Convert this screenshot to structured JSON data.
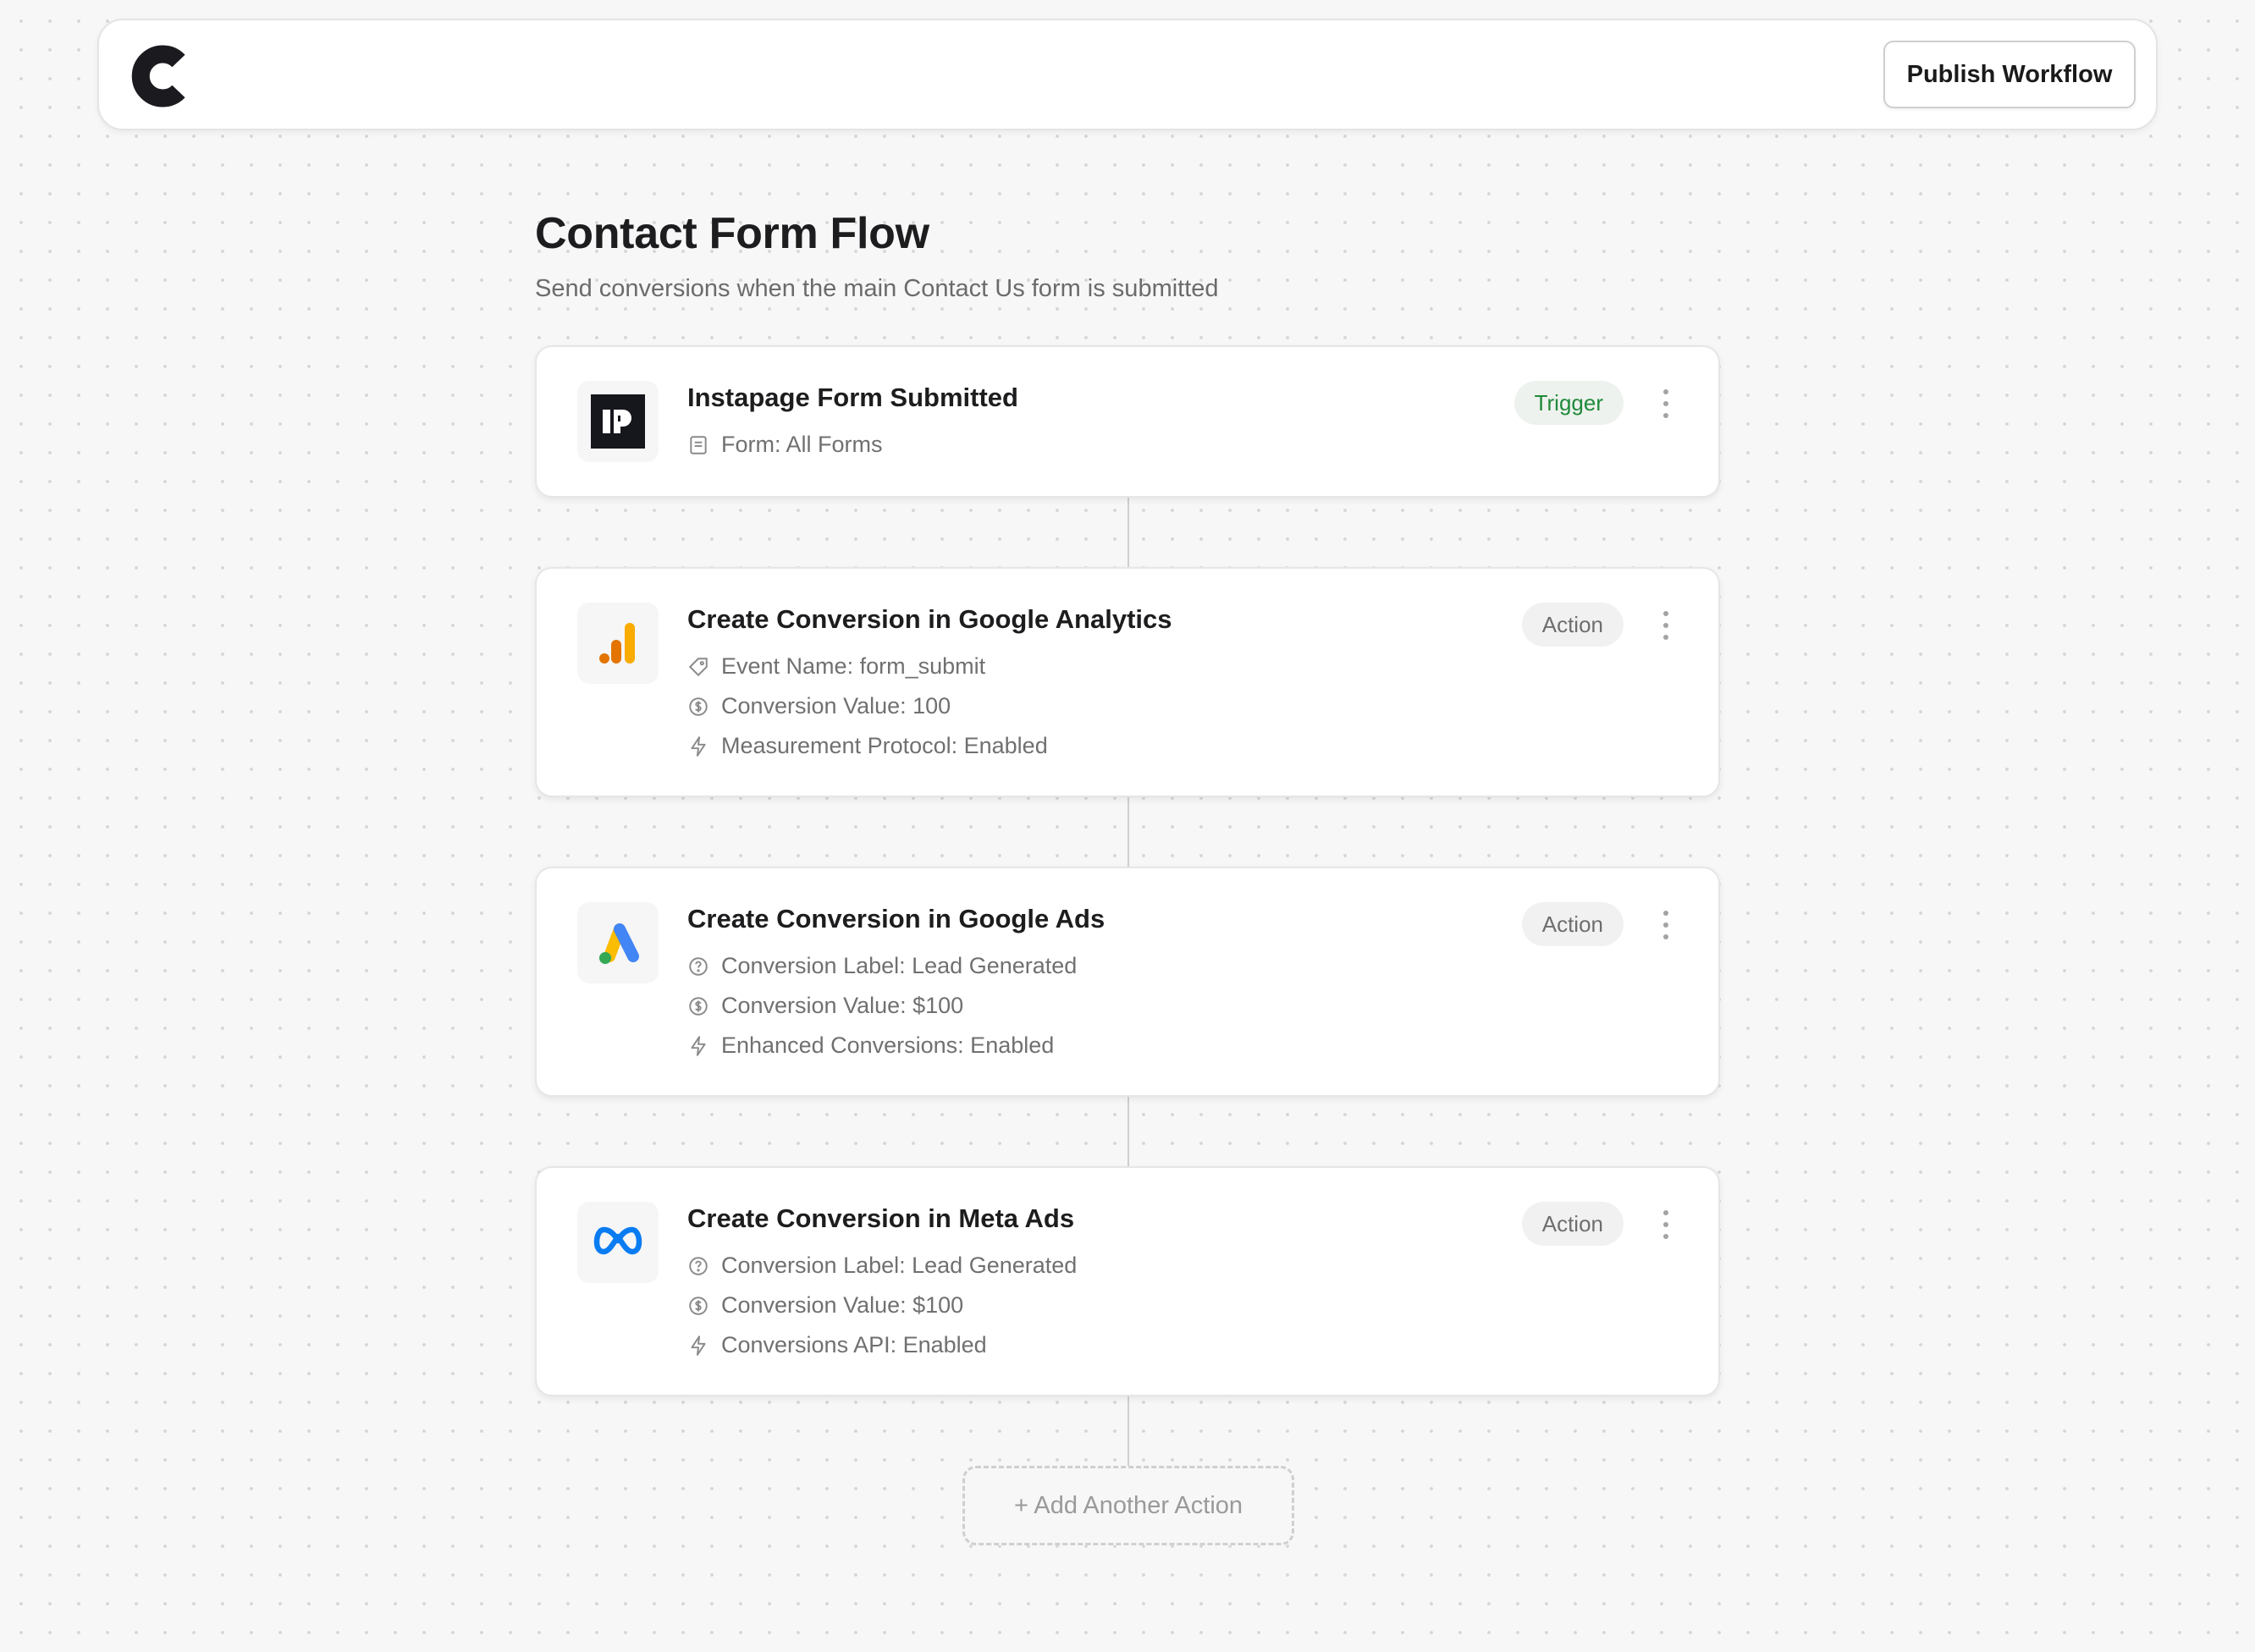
{
  "header": {
    "logo_icon": "c-logo-icon",
    "publish_label": "Publish Workflow"
  },
  "workflow": {
    "title": "Contact Form Flow",
    "subtitle": "Send conversions when the main Contact Us form is submitted"
  },
  "steps": [
    {
      "title": "Instapage Form Submitted",
      "badge": "Trigger",
      "app_icon": "instapage-icon",
      "details": [
        {
          "icon": "form-icon",
          "text": "Form: All Forms"
        }
      ]
    },
    {
      "title": "Create Conversion in Google Analytics",
      "badge": "Action",
      "app_icon": "google-analytics-icon",
      "details": [
        {
          "icon": "tag-icon",
          "text": "Event Name: form_submit"
        },
        {
          "icon": "dollar-icon",
          "text": "Conversion Value: 100"
        },
        {
          "icon": "bolt-icon",
          "text": "Measurement Protocol: Enabled"
        }
      ]
    },
    {
      "title": "Create Conversion in Google Ads",
      "badge": "Action",
      "app_icon": "google-ads-icon",
      "details": [
        {
          "icon": "help-circle-icon",
          "text": "Conversion Label: Lead Generated"
        },
        {
          "icon": "dollar-icon",
          "text": "Conversion Value: $100"
        },
        {
          "icon": "bolt-icon",
          "text": "Enhanced Conversions: Enabled"
        }
      ]
    },
    {
      "title": "Create Conversion in Meta Ads",
      "badge": "Action",
      "app_icon": "meta-icon",
      "details": [
        {
          "icon": "help-circle-icon",
          "text": "Conversion Label: Lead Generated"
        },
        {
          "icon": "dollar-icon",
          "text": "Conversion Value: $100"
        },
        {
          "icon": "bolt-icon",
          "text": "Conversions API: Enabled"
        }
      ]
    }
  ],
  "add_action_label": "+ Add Another Action",
  "colors": {
    "trigger_badge_text": "#1f8a3b",
    "trigger_badge_bg": "#eef2ee",
    "action_badge_bg": "#f1f1f1",
    "canvas_bg": "#f7f7f7"
  }
}
